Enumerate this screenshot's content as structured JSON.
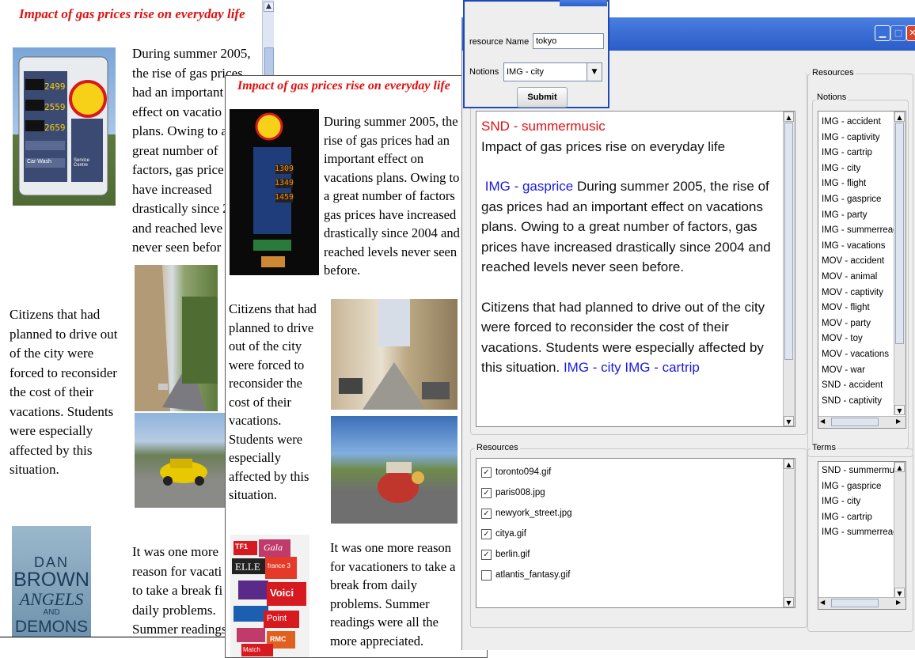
{
  "page1": {
    "title": "Impact of gas prices rise on everyday life",
    "para1": [
      "During summer 2005,",
      "the rise of gas prices",
      "had an important",
      "effect on vacatio",
      "plans. Owing to a",
      "great number of",
      "factors, gas price",
      "have increased",
      "drastically since 2",
      "and reached leve",
      "never seen befor"
    ],
    "para2": [
      "Citizens that had",
      "planned to drive out",
      "of the city were",
      "forced to reconsider",
      "the cost of their",
      "vacations. Students",
      "were especially",
      "affected by this",
      "situation."
    ],
    "para3": [
      "It was one more",
      "reason for vacati",
      "to take a break fi",
      "daily problems.",
      "Summer readings"
    ],
    "book": {
      "line1": "DAN",
      "line2": "BROWN",
      "line3": "ANGELS",
      "line4": "AND",
      "line5": "DEMONS"
    },
    "station": {
      "brand": "Shell",
      "p1": "2499",
      "p2": "2559",
      "p3": "2659",
      "car_wash": "Car Wash",
      "service": "Service Centre"
    }
  },
  "page2": {
    "title": "Impact of gas prices rise on everyday life",
    "para1": [
      "During summer 2005, the",
      "rise of gas prices had an",
      "important effect on",
      "vacations plans. Owing to",
      "a great number of factors",
      "gas prices have increased",
      "drastically since 2004 and",
      "reached levels never seen",
      "before."
    ],
    "para2": [
      "Citizens that had",
      "planned to drive",
      "out of the city",
      "were forced to",
      "reconsider the",
      "cost of their",
      "vacations.",
      "Students were",
      "especially",
      "affected by this",
      "situation."
    ],
    "para3": [
      "It was one more reason",
      "for vacationers to take a",
      "break from daily",
      "problems. Summer",
      "readings were all the",
      "more appreciated."
    ],
    "pump": {
      "p1": "1309",
      "p2": "1349",
      "p3": "1459"
    },
    "mags": [
      "TF1",
      "Gala",
      "ELLE",
      "france 3",
      "Voici",
      "Point",
      "RMC",
      "Match"
    ]
  },
  "dialog": {
    "resource_label": "resource Name",
    "resource_value": "tokyo",
    "notions_label": "Notions",
    "notions_value": "IMG - city",
    "submit": "Submit"
  },
  "app": {
    "editor": {
      "line1": "SND - summermusic",
      "line2": "Impact of gas prices rise on everyday life",
      "tag1": "IMG - gasprice",
      "l3rest": " During summer 2005, the rise of",
      "line4": "gas prices had an important effect on vacations",
      "line5": "plans. Owing to a great number of factors, gas",
      "line6": "prices have increased drastically since 2004 and",
      "line7": "reached levels never seen before.",
      "line8": "Citizens that had planned to drive out of the city",
      "line9": "were forced to reconsider the cost of their",
      "line10": "vacations. Students were especially affected by",
      "line11a": "this situation. ",
      "line11b": " IMG - city IMG - cartrip"
    },
    "resources_group_label": "Resources",
    "resources_list": [
      {
        "name": "toronto094.gif",
        "checked": true
      },
      {
        "name": "paris008.jpg",
        "checked": true
      },
      {
        "name": "newyork_street.jpg",
        "checked": true
      },
      {
        "name": "citya.gif",
        "checked": true
      },
      {
        "name": "berlin.gif",
        "checked": true
      },
      {
        "name": "atlantis_fantasy.gif",
        "checked": false
      }
    ],
    "right_resources_label": "Resources",
    "notions_label": "Notions",
    "notions": [
      "IMG - accident",
      "IMG - captivity",
      "IMG - cartrip",
      "IMG - city",
      "IMG - flight",
      "IMG - gasprice",
      "IMG - party",
      "IMG - summerreadin",
      "IMG - vacations",
      "MOV - accident",
      "MOV - animal",
      "MOV - captivity",
      "MOV - flight",
      "MOV - party",
      "MOV - toy",
      "MOV - vacations",
      "MOV - war",
      "SND - accident",
      "SND - captivity"
    ],
    "terms_label": "Terms",
    "terms": [
      "SND - summermusic",
      "IMG - gasprice",
      "IMG - city",
      "IMG - cartrip",
      "IMG - summerreadin"
    ]
  },
  "colors": {
    "title_red": "#e01010",
    "tag_blue": "#1a1adc",
    "titlebar_blue": "#2b5cc8",
    "close_red": "#d9472b"
  }
}
